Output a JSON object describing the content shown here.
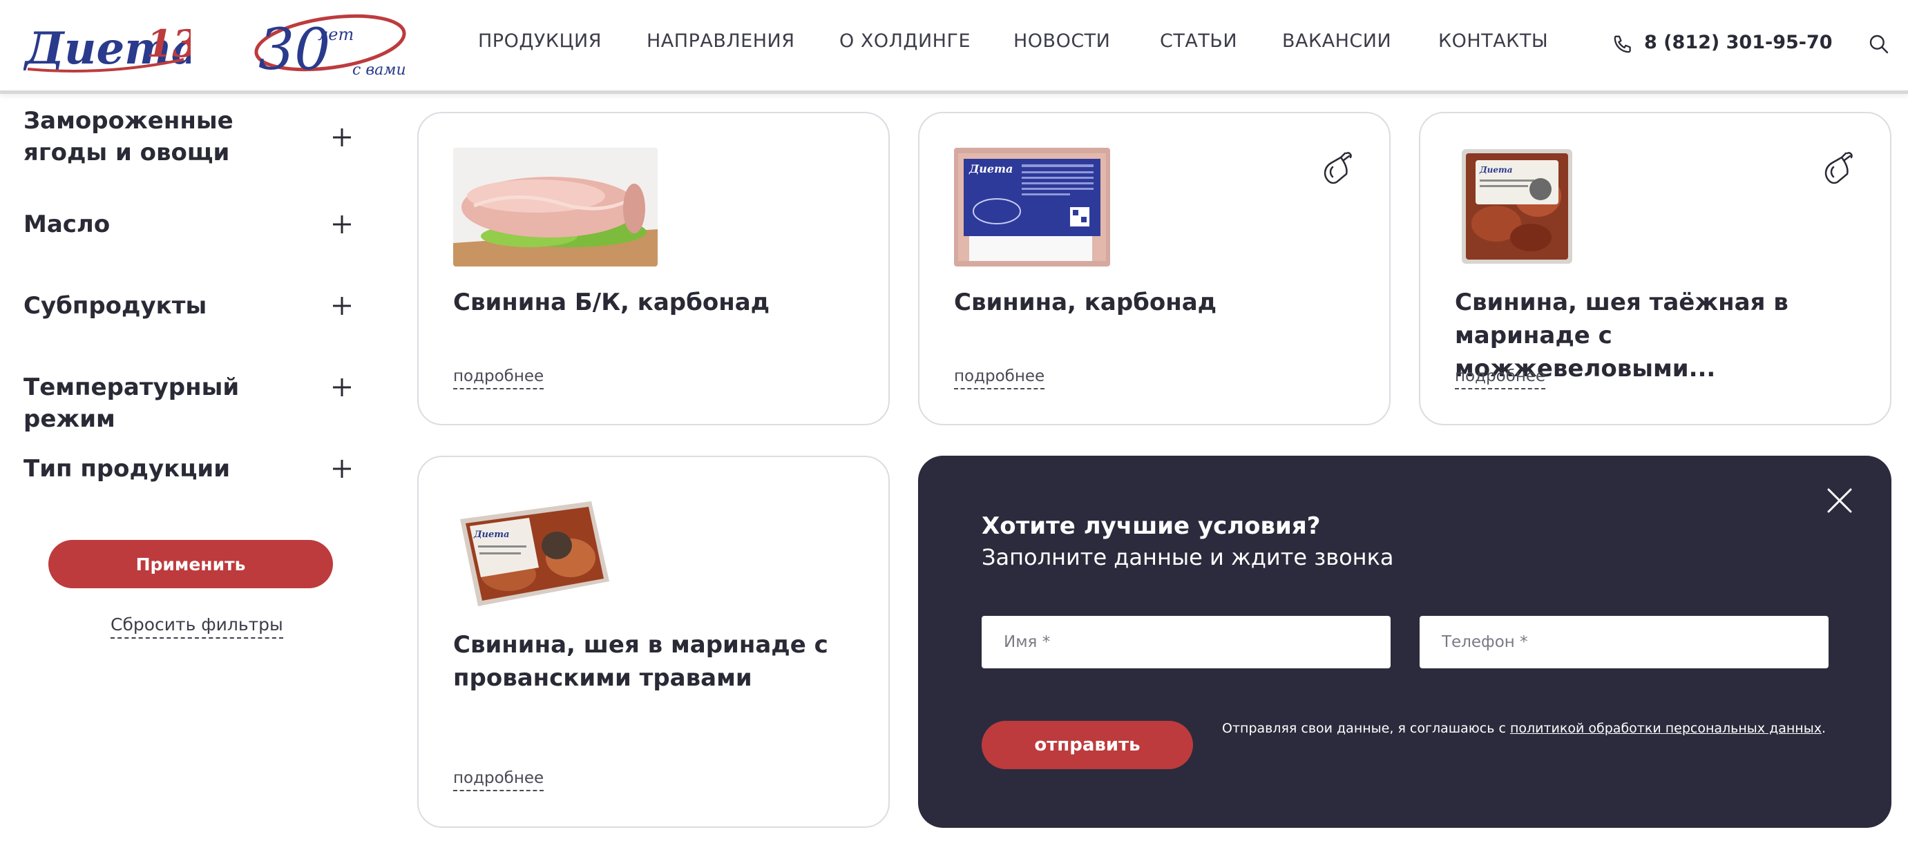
{
  "header": {
    "logo_text": "Диета",
    "logo_num": "13",
    "anniversary_num": "30",
    "anniversary_word": "лет",
    "anniversary_tag": "с вами",
    "nav": [
      "ПРОДУКЦИЯ",
      "НАПРАВЛЕНИЯ",
      "О ХОЛДИНГЕ",
      "НОВОСТИ",
      "СТАТЬИ",
      "ВАКАНСИИ",
      "КОНТАКТЫ"
    ],
    "phone": "8 (812) 301-95-70",
    "icons": {
      "phone": "phone-icon",
      "search": "search-icon"
    }
  },
  "sidebar": {
    "filters": [
      "Замороженные ягоды и овощи",
      "Масло",
      "Субпродукты",
      "Температурный режим",
      "Тип продукции"
    ],
    "apply_label": "Применить",
    "reset_label": "Сбросить фильтры"
  },
  "products": [
    {
      "title": "Свинина Б/К, карбонад",
      "more": "подробнее",
      "icon": ""
    },
    {
      "title": "Свинина, карбонад",
      "more": "подробнее",
      "icon": "ham-icon"
    },
    {
      "title": "Свинина, шея таёжная в маринаде с можжевеловыми...",
      "more": "подробнее",
      "icon": "ham-icon"
    },
    {
      "title": "Свинина, шея в маринаде с прованскими травами",
      "more": "подробнее",
      "icon": ""
    }
  ],
  "callback_form": {
    "title": "Хотите лучшие условия?",
    "subtitle": "Заполните данные и ждите звонка",
    "name_placeholder": "Имя *",
    "phone_placeholder": "Телефон *",
    "submit_label": "отправить",
    "consent_text": "Отправляя свои данные, я соглашаюсь с ",
    "consent_link": "политикой обработки персональных данных",
    "consent_end": "."
  },
  "colors": {
    "accent_red": "#bd3b3d",
    "form_bg": "#2b2b3d",
    "logo_blue": "#2a3a8c"
  }
}
